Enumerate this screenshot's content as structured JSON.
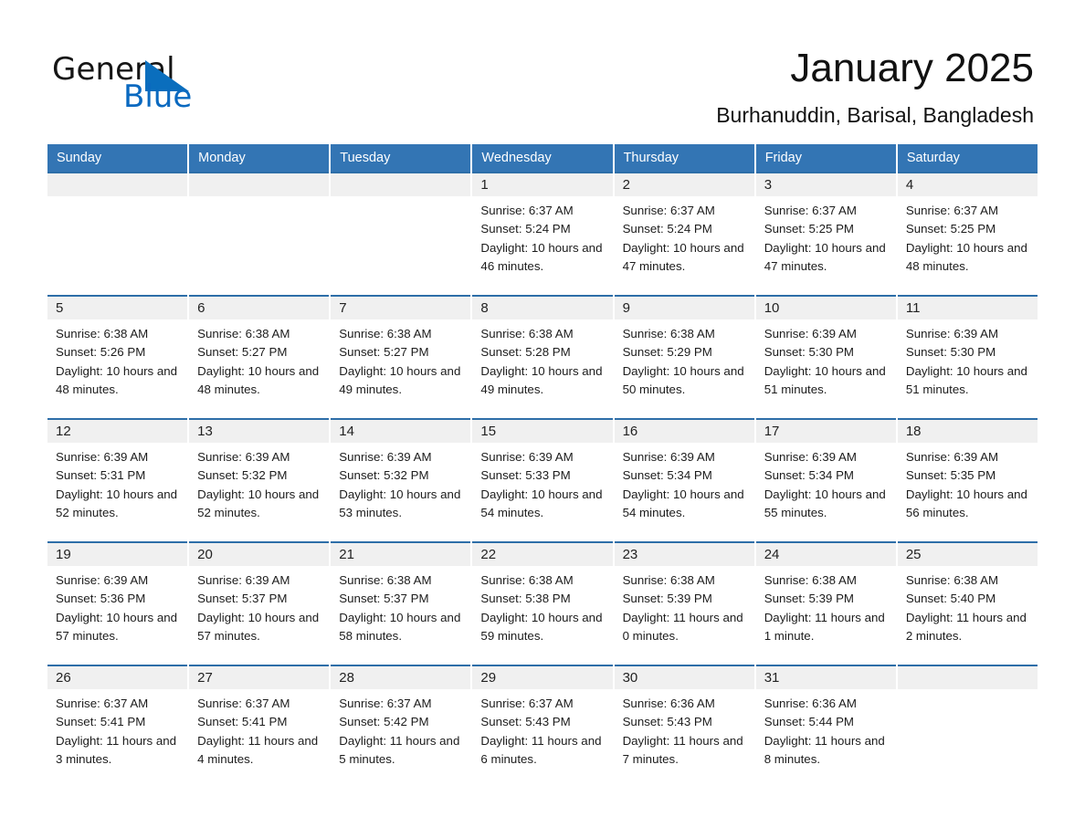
{
  "brand": {
    "name_part1": "General",
    "name_part2": "Blue",
    "triangle_color": "#0a6ebd",
    "blue_text_color": "#0a69c0"
  },
  "header": {
    "title": "January 2025",
    "subtitle": "Burhanuddin, Barisal, Bangladesh"
  },
  "theme": {
    "header_blue": "#3375b4",
    "row_border_blue": "#2d6ea8",
    "day_strip_gray": "#f0f0f0"
  },
  "weekdays": [
    "Sunday",
    "Monday",
    "Tuesday",
    "Wednesday",
    "Thursday",
    "Friday",
    "Saturday"
  ],
  "weeks": [
    [
      {
        "day": "",
        "sunrise": "",
        "sunset": "",
        "daylight": ""
      },
      {
        "day": "",
        "sunrise": "",
        "sunset": "",
        "daylight": ""
      },
      {
        "day": "",
        "sunrise": "",
        "sunset": "",
        "daylight": ""
      },
      {
        "day": "1",
        "sunrise": "Sunrise: 6:37 AM",
        "sunset": "Sunset: 5:24 PM",
        "daylight": "Daylight: 10 hours and 46 minutes."
      },
      {
        "day": "2",
        "sunrise": "Sunrise: 6:37 AM",
        "sunset": "Sunset: 5:24 PM",
        "daylight": "Daylight: 10 hours and 47 minutes."
      },
      {
        "day": "3",
        "sunrise": "Sunrise: 6:37 AM",
        "sunset": "Sunset: 5:25 PM",
        "daylight": "Daylight: 10 hours and 47 minutes."
      },
      {
        "day": "4",
        "sunrise": "Sunrise: 6:37 AM",
        "sunset": "Sunset: 5:25 PM",
        "daylight": "Daylight: 10 hours and 48 minutes."
      }
    ],
    [
      {
        "day": "5",
        "sunrise": "Sunrise: 6:38 AM",
        "sunset": "Sunset: 5:26 PM",
        "daylight": "Daylight: 10 hours and 48 minutes."
      },
      {
        "day": "6",
        "sunrise": "Sunrise: 6:38 AM",
        "sunset": "Sunset: 5:27 PM",
        "daylight": "Daylight: 10 hours and 48 minutes."
      },
      {
        "day": "7",
        "sunrise": "Sunrise: 6:38 AM",
        "sunset": "Sunset: 5:27 PM",
        "daylight": "Daylight: 10 hours and 49 minutes."
      },
      {
        "day": "8",
        "sunrise": "Sunrise: 6:38 AM",
        "sunset": "Sunset: 5:28 PM",
        "daylight": "Daylight: 10 hours and 49 minutes."
      },
      {
        "day": "9",
        "sunrise": "Sunrise: 6:38 AM",
        "sunset": "Sunset: 5:29 PM",
        "daylight": "Daylight: 10 hours and 50 minutes."
      },
      {
        "day": "10",
        "sunrise": "Sunrise: 6:39 AM",
        "sunset": "Sunset: 5:30 PM",
        "daylight": "Daylight: 10 hours and 51 minutes."
      },
      {
        "day": "11",
        "sunrise": "Sunrise: 6:39 AM",
        "sunset": "Sunset: 5:30 PM",
        "daylight": "Daylight: 10 hours and 51 minutes."
      }
    ],
    [
      {
        "day": "12",
        "sunrise": "Sunrise: 6:39 AM",
        "sunset": "Sunset: 5:31 PM",
        "daylight": "Daylight: 10 hours and 52 minutes."
      },
      {
        "day": "13",
        "sunrise": "Sunrise: 6:39 AM",
        "sunset": "Sunset: 5:32 PM",
        "daylight": "Daylight: 10 hours and 52 minutes."
      },
      {
        "day": "14",
        "sunrise": "Sunrise: 6:39 AM",
        "sunset": "Sunset: 5:32 PM",
        "daylight": "Daylight: 10 hours and 53 minutes."
      },
      {
        "day": "15",
        "sunrise": "Sunrise: 6:39 AM",
        "sunset": "Sunset: 5:33 PM",
        "daylight": "Daylight: 10 hours and 54 minutes."
      },
      {
        "day": "16",
        "sunrise": "Sunrise: 6:39 AM",
        "sunset": "Sunset: 5:34 PM",
        "daylight": "Daylight: 10 hours and 54 minutes."
      },
      {
        "day": "17",
        "sunrise": "Sunrise: 6:39 AM",
        "sunset": "Sunset: 5:34 PM",
        "daylight": "Daylight: 10 hours and 55 minutes."
      },
      {
        "day": "18",
        "sunrise": "Sunrise: 6:39 AM",
        "sunset": "Sunset: 5:35 PM",
        "daylight": "Daylight: 10 hours and 56 minutes."
      }
    ],
    [
      {
        "day": "19",
        "sunrise": "Sunrise: 6:39 AM",
        "sunset": "Sunset: 5:36 PM",
        "daylight": "Daylight: 10 hours and 57 minutes."
      },
      {
        "day": "20",
        "sunrise": "Sunrise: 6:39 AM",
        "sunset": "Sunset: 5:37 PM",
        "daylight": "Daylight: 10 hours and 57 minutes."
      },
      {
        "day": "21",
        "sunrise": "Sunrise: 6:38 AM",
        "sunset": "Sunset: 5:37 PM",
        "daylight": "Daylight: 10 hours and 58 minutes."
      },
      {
        "day": "22",
        "sunrise": "Sunrise: 6:38 AM",
        "sunset": "Sunset: 5:38 PM",
        "daylight": "Daylight: 10 hours and 59 minutes."
      },
      {
        "day": "23",
        "sunrise": "Sunrise: 6:38 AM",
        "sunset": "Sunset: 5:39 PM",
        "daylight": "Daylight: 11 hours and 0 minutes."
      },
      {
        "day": "24",
        "sunrise": "Sunrise: 6:38 AM",
        "sunset": "Sunset: 5:39 PM",
        "daylight": "Daylight: 11 hours and 1 minute."
      },
      {
        "day": "25",
        "sunrise": "Sunrise: 6:38 AM",
        "sunset": "Sunset: 5:40 PM",
        "daylight": "Daylight: 11 hours and 2 minutes."
      }
    ],
    [
      {
        "day": "26",
        "sunrise": "Sunrise: 6:37 AM",
        "sunset": "Sunset: 5:41 PM",
        "daylight": "Daylight: 11 hours and 3 minutes."
      },
      {
        "day": "27",
        "sunrise": "Sunrise: 6:37 AM",
        "sunset": "Sunset: 5:41 PM",
        "daylight": "Daylight: 11 hours and 4 minutes."
      },
      {
        "day": "28",
        "sunrise": "Sunrise: 6:37 AM",
        "sunset": "Sunset: 5:42 PM",
        "daylight": "Daylight: 11 hours and 5 minutes."
      },
      {
        "day": "29",
        "sunrise": "Sunrise: 6:37 AM",
        "sunset": "Sunset: 5:43 PM",
        "daylight": "Daylight: 11 hours and 6 minutes."
      },
      {
        "day": "30",
        "sunrise": "Sunrise: 6:36 AM",
        "sunset": "Sunset: 5:43 PM",
        "daylight": "Daylight: 11 hours and 7 minutes."
      },
      {
        "day": "31",
        "sunrise": "Sunrise: 6:36 AM",
        "sunset": "Sunset: 5:44 PM",
        "daylight": "Daylight: 11 hours and 8 minutes."
      },
      {
        "day": "",
        "sunrise": "",
        "sunset": "",
        "daylight": ""
      }
    ]
  ]
}
